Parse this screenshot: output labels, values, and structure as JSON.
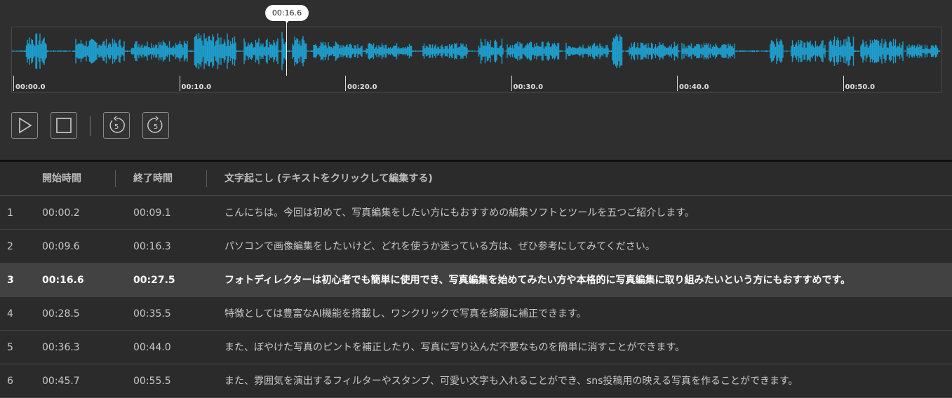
{
  "player": {
    "current_time": "00:16.6",
    "ticks": [
      "00:00.0",
      "00:10.0",
      "00:20.0",
      "00:30.0",
      "00:40.0",
      "00:50.0"
    ],
    "colors": {
      "waveform": "#1ea0d0",
      "background": "#2b2b2b"
    },
    "controls": [
      {
        "name": "play-button",
        "icon": "play-icon"
      },
      {
        "name": "stop-button",
        "icon": "stop-icon"
      },
      {
        "name": "rewind-5-button",
        "icon": "rewind-5-icon",
        "label": "5"
      },
      {
        "name": "forward-5-button",
        "icon": "forward-5-icon",
        "label": "5"
      }
    ]
  },
  "table": {
    "headers": {
      "start": "開始時間",
      "end": "終了時間",
      "text": "文字起こし (テキストをクリックして編集する)"
    },
    "active_row": 3,
    "rows": [
      {
        "idx": "1",
        "start": "00:00.2",
        "end": "00:09.1",
        "text": "こんにちは。今回は初めて、写真編集をしたい方にもおすすめの編集ソフトとツールを五つご紹介します。"
      },
      {
        "idx": "2",
        "start": "00:09.6",
        "end": "00:16.3",
        "text": "パソコンで画像編集をしたいけど、どれを使うか迷っている方は、ぜひ参考にしてみてください。"
      },
      {
        "idx": "3",
        "start": "00:16.6",
        "end": "00:27.5",
        "text": "フォトディレクターは初心者でも簡単に使用でき、写真編集を始めてみたい方や本格的に写真編集に取り組みたいという方にもおすすめです。"
      },
      {
        "idx": "4",
        "start": "00:28.5",
        "end": "00:35.5",
        "text": "特徴としては豊富なAI機能を搭載し、ワンクリックで写真を綺麗に補正できます。"
      },
      {
        "idx": "5",
        "start": "00:36.3",
        "end": "00:44.0",
        "text": "また、ぼやけた写真のピントを補正したり、写真に写り込んだ不要なものを簡単に消すことができます。"
      },
      {
        "idx": "6",
        "start": "00:45.7",
        "end": "00:55.5",
        "text": "また、雰囲気を演出するフィルターやスタンプ、可愛い文字も入れることができ、sns投稿用の映える写真を作ることができます。"
      }
    ]
  }
}
